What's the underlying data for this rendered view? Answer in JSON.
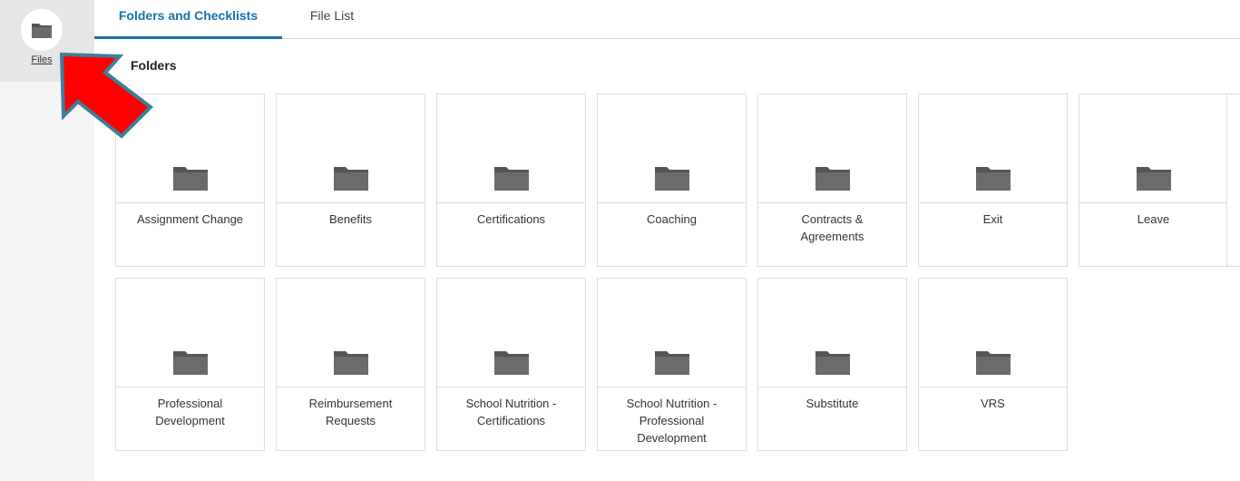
{
  "sidebar": {
    "files_label": "Files",
    "files_icon": "folder-icon"
  },
  "tabs": [
    {
      "label": "Folders and Checklists",
      "active": true
    },
    {
      "label": "File List",
      "active": false
    }
  ],
  "section_title": "Folders",
  "folders": [
    {
      "name": "Assignment Change"
    },
    {
      "name": "Benefits"
    },
    {
      "name": "Certifications"
    },
    {
      "name": "Coaching"
    },
    {
      "name": "Contracts & Agreements"
    },
    {
      "name": "Exit"
    },
    {
      "name": "Leave"
    },
    {
      "name": "Professional Development"
    },
    {
      "name": "Reimbursement Requests"
    },
    {
      "name": "School Nutrition - Certifications"
    },
    {
      "name": "School Nutrition - Professional Development"
    },
    {
      "name": "Substitute"
    },
    {
      "name": "VRS"
    }
  ],
  "colors": {
    "accent": "#1a6fb0",
    "folder_icon": "#666666",
    "annotation_arrow": "#ff0000",
    "annotation_arrow_border": "#3d7f99"
  },
  "annotation": {
    "icon": "arrow-pointer-icon"
  }
}
